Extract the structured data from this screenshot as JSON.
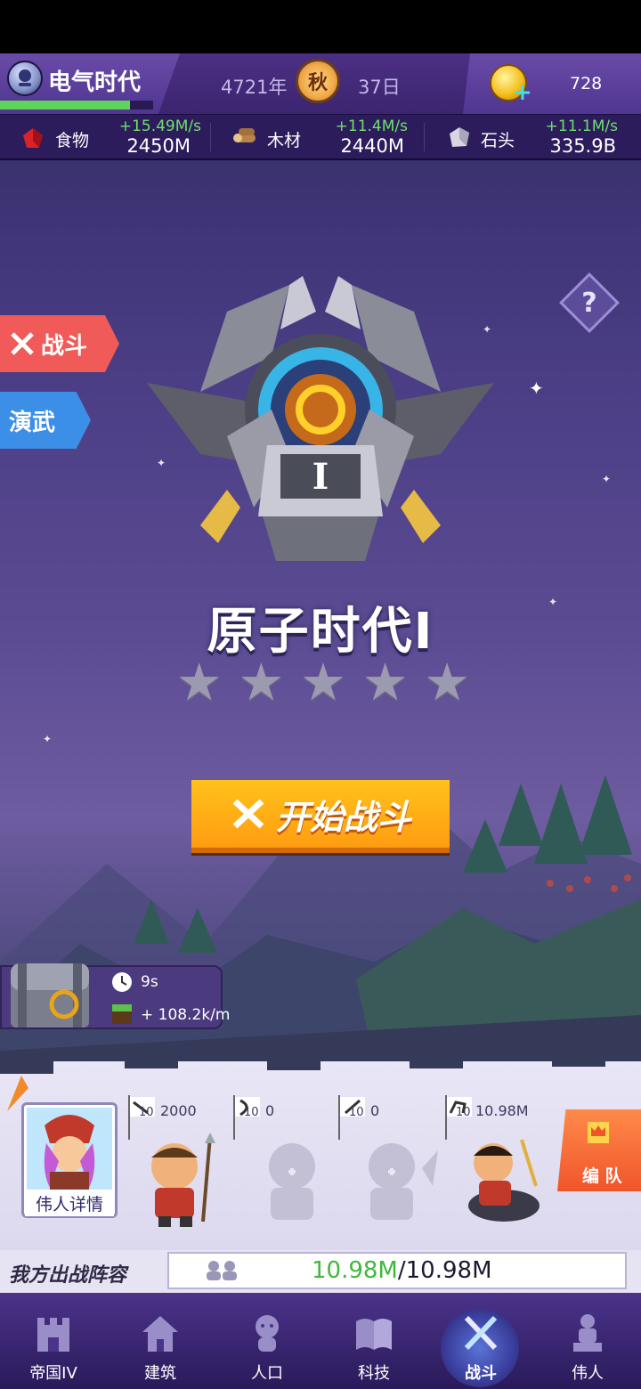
{
  "header": {
    "era_name": "电气时代",
    "era_progress": 0.85,
    "year": "4721年",
    "season": "秋",
    "day": "37日",
    "gems": "728"
  },
  "resources": [
    {
      "name": "食物",
      "rate": "+15.49M/s",
      "amount": "2450M",
      "icon": "meat-icon"
    },
    {
      "name": "木材",
      "rate": "+11.4M/s",
      "amount": "2440M",
      "icon": "wood-icon"
    },
    {
      "name": "石头",
      "rate": "+11.1M/s",
      "amount": "335.9B",
      "icon": "stone-icon"
    }
  ],
  "side_tabs": {
    "battle": "战斗",
    "drill": "演武"
  },
  "help": "?",
  "stage": {
    "emblem_numeral": "I",
    "title": "原子时代I",
    "stars_earned": 0,
    "stars_total": 5
  },
  "start_button": "开始战斗",
  "chest": {
    "timer": "9s",
    "rate": "+ 108.2k/m"
  },
  "lineup": {
    "hero_detail": "伟人详情",
    "slots": [
      {
        "level": "10",
        "count": "2000",
        "icon": "spear-icon",
        "filled": true
      },
      {
        "level": "10",
        "count": "0",
        "icon": "bow-icon",
        "filled": false
      },
      {
        "level": "10",
        "count": "0",
        "icon": "sword-icon",
        "filled": false
      },
      {
        "level": "10",
        "count": "10.98M",
        "icon": "horse-icon",
        "filled": true
      }
    ],
    "formation": "编 队",
    "label": "我方出战阵容",
    "power_current": "10.98M",
    "power_max": "/10.98M"
  },
  "nav": [
    {
      "label": "帝国IV",
      "icon": "castle-icon"
    },
    {
      "label": "建筑",
      "icon": "house-icon"
    },
    {
      "label": "人口",
      "icon": "person-icon"
    },
    {
      "label": "科技",
      "icon": "book-icon"
    },
    {
      "label": "战斗",
      "icon": "crossed-swords-icon",
      "active": true
    },
    {
      "label": "伟人",
      "icon": "statue-icon"
    }
  ],
  "colors": {
    "header_purple": "#4b2f84",
    "rate_green": "#6ee06a",
    "start_orange": "#ff9c12",
    "battle_tab_red": "#f05a58",
    "drill_tab_blue": "#3b8fe6"
  }
}
